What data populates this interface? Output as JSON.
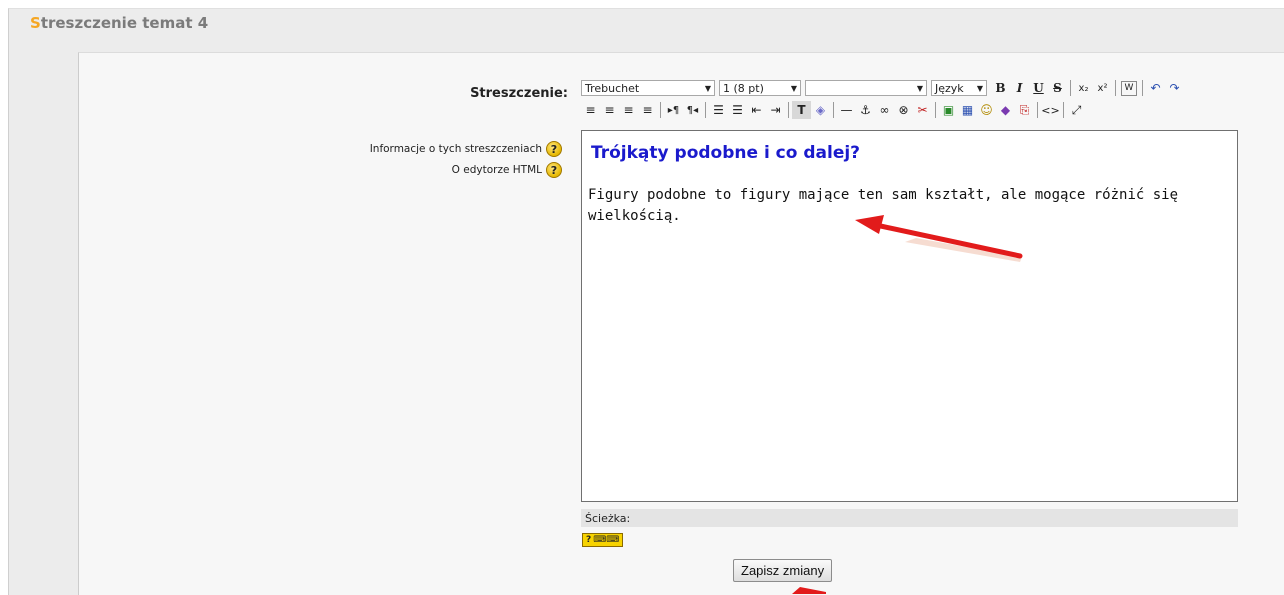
{
  "page": {
    "heading_first": "S",
    "heading_rest": "treszczenie temat 4"
  },
  "form": {
    "summary_label": "Streszczenie:",
    "help_links": [
      "Informacje o tych streszczeniach",
      "O edytorze HTML"
    ],
    "help_icon_glyph": "?"
  },
  "toolbar": {
    "font_family": "Trebuchet",
    "font_size": "1 (8 pt)",
    "style_value": "",
    "language": "Język",
    "bold": "B",
    "italic": "I",
    "underline": "U",
    "strike": "S",
    "subscript": "x₂",
    "superscript": "x²",
    "paste_word": "W",
    "undo": "↶",
    "redo": "↷",
    "align_left": "≡",
    "align_center": "≡",
    "align_right": "≡",
    "justify": "≡",
    "ltr": "▸¶",
    "rtl": "¶◂",
    "ordered_list": "☰",
    "unordered_list": "☰",
    "outdent": "⇤",
    "indent": "⇥",
    "text_color": "T",
    "bg_color": "◈",
    "hr": "—",
    "anchor": "⚓",
    "link": "∞",
    "unlink": "⊗",
    "nolink": "✂",
    "image": "▣",
    "table": "▦",
    "smiley": "☺",
    "special_char": "◆",
    "search": "⎘",
    "html_source": "<>",
    "fullscreen": "⤢"
  },
  "editor": {
    "heading": "Trójkąty podobne i co dalej?",
    "paragraph": "Figury podobne to figury mające ten sam kształt, ale mogące różnić się wielkością."
  },
  "path_bar": {
    "label": "Ścieżka:"
  },
  "keyboard_help": {
    "glyph": "?",
    "keys": "⌨⌨"
  },
  "save_button": {
    "label": "Zapisz zmiany"
  },
  "colors": {
    "accent": "#f5a623",
    "heading_link": "#1a1acc",
    "annotation_arrow": "#e21b1b"
  }
}
